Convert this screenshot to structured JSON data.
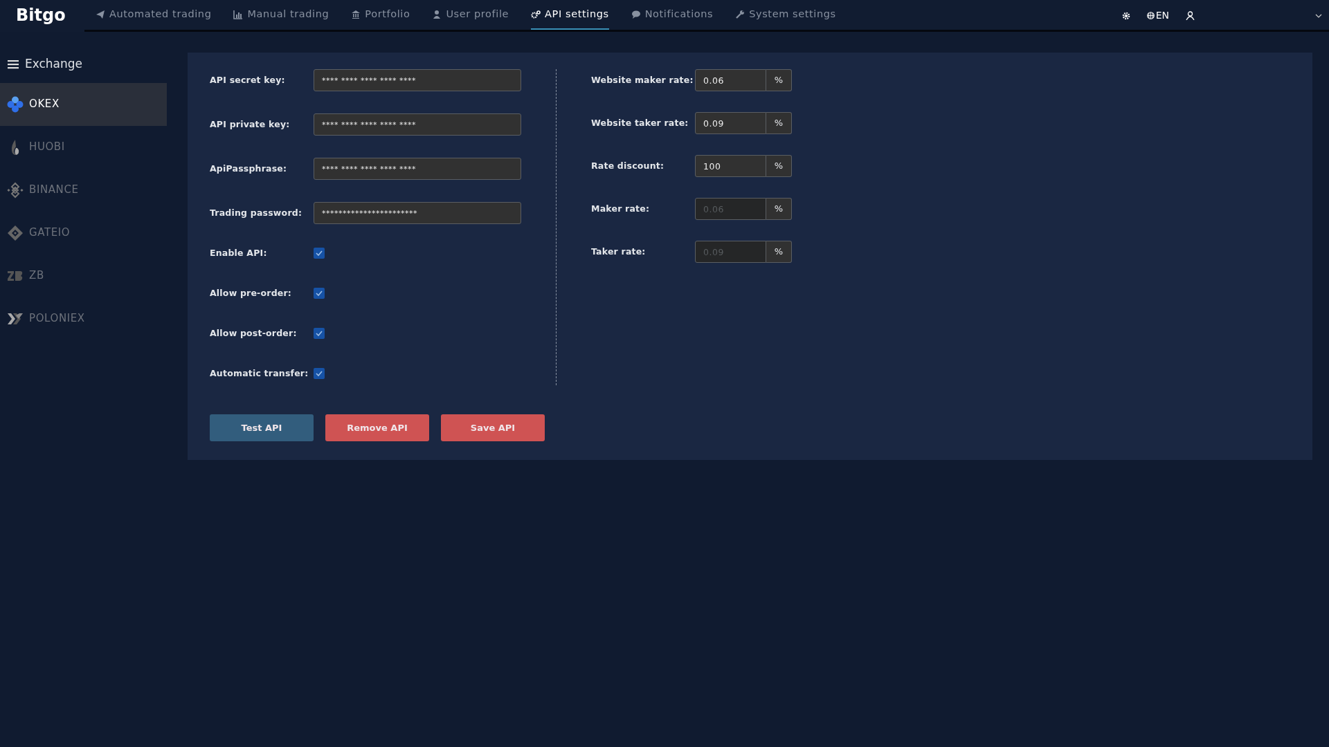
{
  "logo": "Bitgo",
  "nav_tabs": [
    {
      "label": "Automated trading",
      "selected": false
    },
    {
      "label": "Manual trading",
      "selected": false
    },
    {
      "label": "Portfolio",
      "selected": false
    },
    {
      "label": "User profile",
      "selected": false
    },
    {
      "label": "API settings",
      "selected": true
    },
    {
      "label": "Notifications",
      "selected": false
    },
    {
      "label": "System settings",
      "selected": false
    }
  ],
  "language": "EN",
  "sidebar": {
    "title": "Exchange",
    "items": [
      {
        "label": "OKEX",
        "selected": true
      },
      {
        "label": "HUOBI",
        "selected": false
      },
      {
        "label": "BINANCE",
        "selected": false
      },
      {
        "label": "GATEIO",
        "selected": false
      },
      {
        "label": "ZB",
        "selected": false
      },
      {
        "label": "POLONIEX",
        "selected": false
      }
    ]
  },
  "credentials": [
    {
      "label": "API secret key:",
      "value": "**** **** **** **** ****"
    },
    {
      "label": "API private key:",
      "value": "**** **** **** **** ****"
    },
    {
      "label": "ApiPassphrase:",
      "value": "**** **** **** **** ****"
    },
    {
      "label": "Trading password:",
      "value": "***********************"
    }
  ],
  "options": [
    {
      "label": "Enable API:",
      "checked": true
    },
    {
      "label": "Allow pre-order:",
      "checked": true
    },
    {
      "label": "Allow post-order:",
      "checked": true
    },
    {
      "label": "Automatic transfer:",
      "checked": true
    }
  ],
  "rates": [
    {
      "label": "Website maker rate:",
      "value": "0.06",
      "unit": "%",
      "disabled": false
    },
    {
      "label": "Website taker rate:",
      "value": "0.09",
      "unit": "%",
      "disabled": false
    },
    {
      "label": "Rate discount:",
      "value": "100",
      "unit": "%",
      "disabled": false
    },
    {
      "label": "Maker rate:",
      "value": "0.06",
      "unit": "%",
      "disabled": true
    },
    {
      "label": "Taker rate:",
      "value": "0.09",
      "unit": "%",
      "disabled": true
    }
  ],
  "buttons": [
    {
      "label": "Test API",
      "kind": "info"
    },
    {
      "label": "Remove API",
      "kind": "danger"
    },
    {
      "label": "Save API",
      "kind": "danger"
    }
  ]
}
